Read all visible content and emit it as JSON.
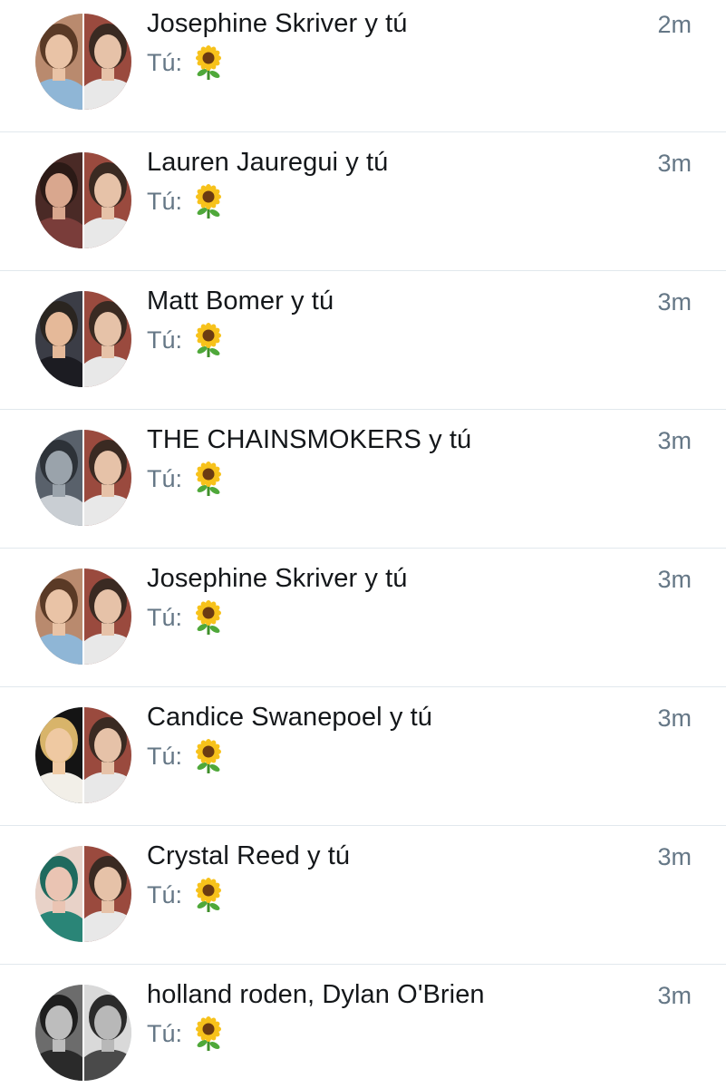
{
  "conversations": [
    {
      "title": "Josephine Skriver y tú",
      "time": "2m",
      "sender": "Tú:",
      "message_emoji": "sunflower-emoji",
      "avatar_left": {
        "bg": "#b98a6e",
        "hair": "#5a3a26",
        "skin": "#e9c3a6",
        "shirt": "#8fb6d6"
      },
      "avatar_right": {
        "bg": "#9a4a3e",
        "hair": "#3a2a22",
        "skin": "#e6c2a8",
        "shirt": "#e8e8e8"
      }
    },
    {
      "title": "Lauren Jauregui y tú",
      "time": "3m",
      "sender": "Tú:",
      "message_emoji": "sunflower-emoji",
      "avatar_left": {
        "bg": "#4a2a26",
        "hair": "#2b1a16",
        "skin": "#d9a78e",
        "shirt": "#7a3d3a"
      },
      "avatar_right": {
        "bg": "#9a4a3e",
        "hair": "#3a2a22",
        "skin": "#e6c2a8",
        "shirt": "#e8e8e8"
      }
    },
    {
      "title": "Matt Bomer y tú",
      "time": "3m",
      "sender": "Tú:",
      "message_emoji": "sunflower-emoji",
      "avatar_left": {
        "bg": "#3b3d46",
        "hair": "#2a2520",
        "skin": "#e5b999",
        "shirt": "#1c1c22"
      },
      "avatar_right": {
        "bg": "#9a4a3e",
        "hair": "#3a2a22",
        "skin": "#e6c2a8",
        "shirt": "#e8e8e8"
      }
    },
    {
      "title": "THE CHAINSMOKERS y tú",
      "time": "3m",
      "sender": "Tú:",
      "message_emoji": "sunflower-emoji",
      "avatar_left": {
        "bg": "#59616b",
        "hair": "#2d3238",
        "skin": "#9aa3ab",
        "shirt": "#c9ced3"
      },
      "avatar_right": {
        "bg": "#9a4a3e",
        "hair": "#3a2a22",
        "skin": "#e6c2a8",
        "shirt": "#e8e8e8"
      }
    },
    {
      "title": "Josephine Skriver y tú",
      "time": "3m",
      "sender": "Tú:",
      "message_emoji": "sunflower-emoji",
      "avatar_left": {
        "bg": "#b98a6e",
        "hair": "#5a3a26",
        "skin": "#e9c3a6",
        "shirt": "#8fb6d6"
      },
      "avatar_right": {
        "bg": "#9a4a3e",
        "hair": "#3a2a22",
        "skin": "#e6c2a8",
        "shirt": "#e8e8e8"
      }
    },
    {
      "title": "Candice Swanepoel y tú",
      "time": "3m",
      "sender": "Tú:",
      "message_emoji": "sunflower-emoji",
      "avatar_left": {
        "bg": "#141414",
        "hair": "#d8b46a",
        "skin": "#efc9a2",
        "shirt": "#f2efe8"
      },
      "avatar_right": {
        "bg": "#9a4a3e",
        "hair": "#3a2a22",
        "skin": "#e6c2a8",
        "shirt": "#e8e8e8"
      }
    },
    {
      "title": "Crystal Reed y tú",
      "time": "3m",
      "sender": "Tú:",
      "message_emoji": "sunflower-emoji",
      "avatar_left": {
        "bg": "#e8d2c8",
        "hair": "#1f6a5e",
        "skin": "#eac4b3",
        "shirt": "#2a8577"
      },
      "avatar_right": {
        "bg": "#9a4a3e",
        "hair": "#3a2a22",
        "skin": "#e6c2a8",
        "shirt": "#e8e8e8"
      }
    },
    {
      "title": "holland roden, Dylan O'Brien",
      "time": "3m",
      "sender": "Tú:",
      "message_emoji": "sunflower-emoji",
      "avatar_left": {
        "bg": "#6c6c6c",
        "hair": "#1e1e1e",
        "skin": "#bdbdbd",
        "shirt": "#2a2a2a"
      },
      "avatar_right": {
        "bg": "#d9d9d9",
        "hair": "#2b2b2b",
        "skin": "#b8b8b8",
        "shirt": "#4a4a4a"
      }
    }
  ]
}
